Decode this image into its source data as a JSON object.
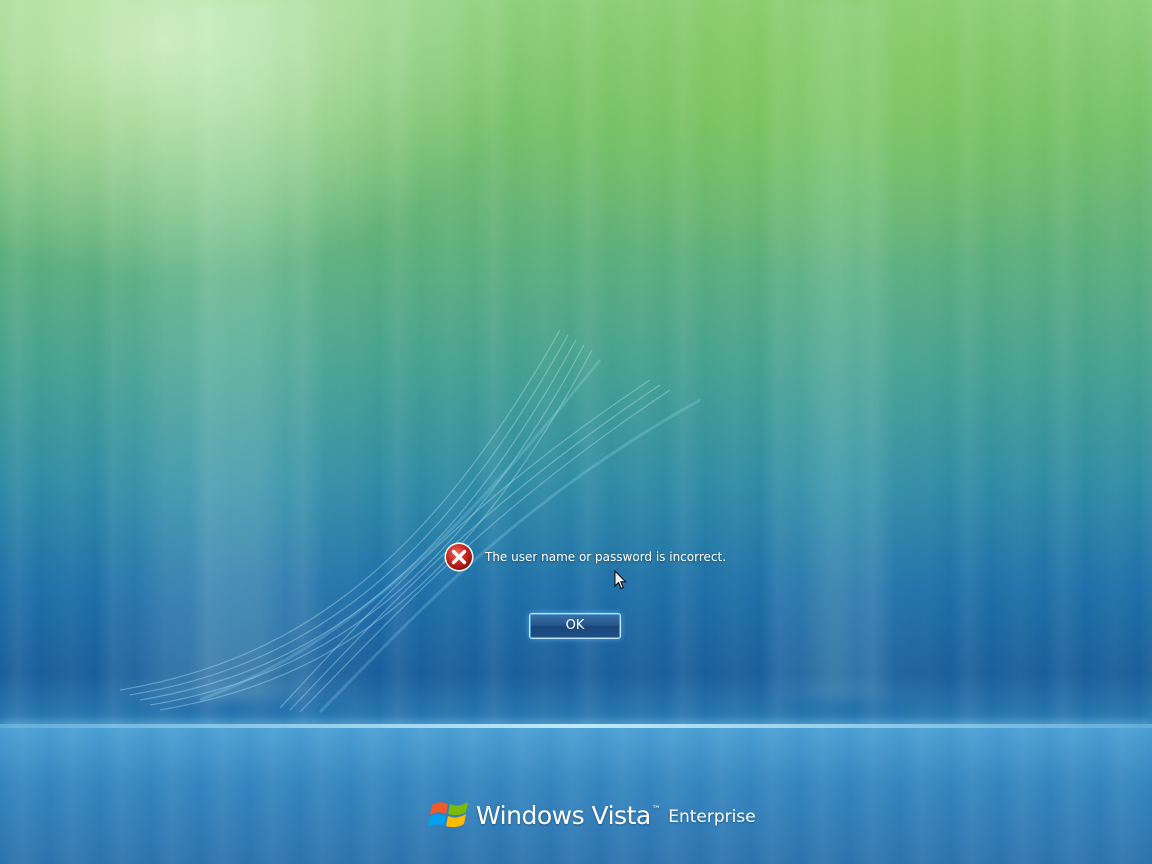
{
  "message": {
    "icon": "error-icon",
    "text": "The user name or password is incorrect."
  },
  "ok_button": {
    "label": "OK"
  },
  "branding": {
    "logo_icon": "windows-flag-icon",
    "product": "Windows Vista",
    "trademark": "™",
    "edition": "Enterprise"
  },
  "colors": {
    "error_red": "#c8261e",
    "button_blue": "#23558c",
    "text": "#ffffff"
  }
}
